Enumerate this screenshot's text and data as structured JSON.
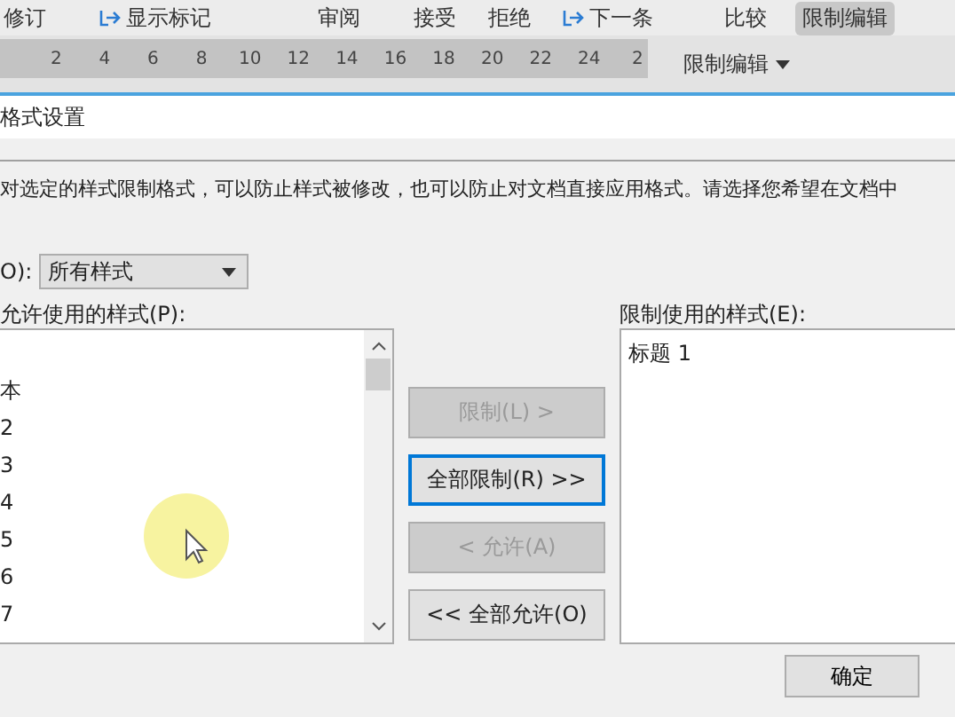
{
  "ribbon": {
    "items": [
      {
        "label": "修订",
        "kind": "plain"
      },
      {
        "label": "显示标记",
        "kind": "icon"
      },
      {
        "label": "审阅",
        "kind": "plain"
      },
      {
        "label": "接受",
        "kind": "plain"
      },
      {
        "label": "拒绝",
        "kind": "plain"
      },
      {
        "label": "下一条",
        "kind": "icon"
      },
      {
        "label": "比较",
        "kind": "plain"
      },
      {
        "label": "限制编辑",
        "kind": "highlighted"
      }
    ]
  },
  "ruler": {
    "numbers": [
      "2",
      "4",
      "6",
      "8",
      "10",
      "12",
      "14",
      "16",
      "18",
      "20",
      "22",
      "24",
      "2"
    ]
  },
  "side_pane": {
    "title": "限制编辑"
  },
  "dialog": {
    "title": "格式设置",
    "description": "对选定的样式限制格式，可以防止样式被修改，也可以防止对文档直接应用格式。请选择您希望在文档中",
    "filter": {
      "label": "O):",
      "value": "所有样式"
    },
    "allowed": {
      "label": "允许使用的样式(P):",
      "items": [
        {
          "label": "本",
          "selected": false
        },
        {
          "label": "2",
          "selected": false
        },
        {
          "label": "3",
          "selected": false
        },
        {
          "label": "4",
          "selected": false
        },
        {
          "label": "5",
          "selected": false
        },
        {
          "label": "6",
          "selected": false
        },
        {
          "label": "7",
          "selected": false
        }
      ]
    },
    "restricted": {
      "label": "限制使用的样式(E):",
      "items": [
        {
          "label": "标题 1",
          "selected": false
        }
      ]
    },
    "actions": [
      {
        "label": "限制(L) >",
        "disabled": true,
        "focused": false
      },
      {
        "label": "全部限制(R) >>",
        "disabled": false,
        "focused": true
      },
      {
        "label": "< 允许(A)",
        "disabled": true,
        "focused": false
      },
      {
        "label": "<< 全部允许(O)",
        "disabled": false,
        "focused": false
      }
    ],
    "footer_buttons": [
      "确定"
    ]
  }
}
